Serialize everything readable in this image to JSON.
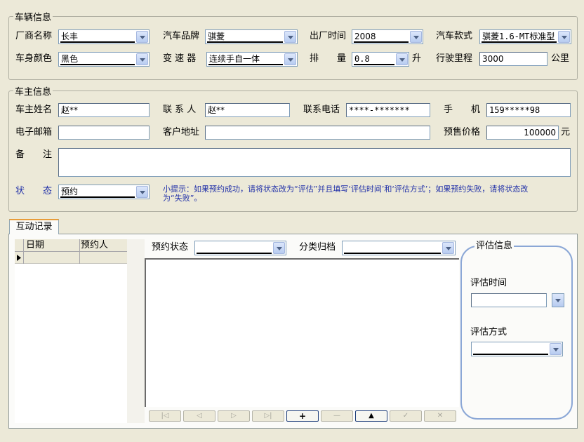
{
  "vehicle": {
    "group_title": "车辆信息",
    "manufacturer_label": "厂商名称",
    "manufacturer_value": "长丰",
    "brand_label": "汽车品牌",
    "brand_value": "骐菱",
    "year_label": "出厂时间",
    "year_value": "2008",
    "model_label": "汽车款式",
    "model_value": "骐菱1.6-MT标准型",
    "color_label": "车身颜色",
    "color_value": "黑色",
    "gearbox_label": "变 速 器",
    "gearbox_value": "连续手自一体",
    "displacement_label": "排　　量",
    "displacement_value": "0.8",
    "displacement_unit": "升",
    "mileage_label": "行驶里程",
    "mileage_value": "3000",
    "mileage_unit": "公里"
  },
  "owner": {
    "group_title": "车主信息",
    "name_label": "车主姓名",
    "name_value": "赵**",
    "contact_label": "联 系 人",
    "contact_value": "赵**",
    "phone_label": "联系电话",
    "phone_value": "****-*******",
    "mobile_label": "手　　机",
    "mobile_value": "159*****98",
    "email_label": "电子邮箱",
    "email_value": "",
    "address_label": "客户地址",
    "address_value": "",
    "price_label": "预售价格",
    "price_value": "100000",
    "price_unit": "元",
    "remark_label": "备　　注",
    "remark_value": "",
    "status_label": "状　　态",
    "status_value": "预约",
    "hint": "小提示：如果预约成功，请将状态改为“评估”并且填写‘评估时间’和‘评估方式’；如果预约失败，请将状态改为“失败”。"
  },
  "tabs": {
    "interaction": "互动记录"
  },
  "records_grid": {
    "col_date": "日期",
    "col_appointee": "预约人"
  },
  "filters": {
    "booking_status_label": "预约状态",
    "booking_status_value": "",
    "category_label": "分类归档",
    "category_value": ""
  },
  "navigator": [
    "|◁",
    "◁",
    "▷",
    "▷|",
    "+",
    "—",
    "▲",
    "✓",
    "✕"
  ],
  "evaluation": {
    "title": "评估信息",
    "time_label": "评估时间",
    "time_value": "",
    "method_label": "评估方式",
    "method_value": ""
  }
}
